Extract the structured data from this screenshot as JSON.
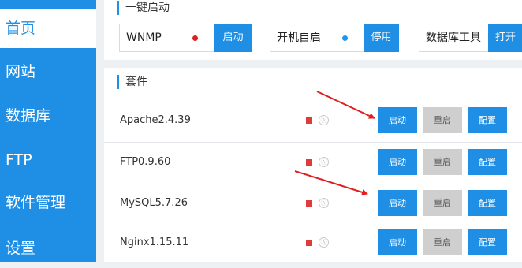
{
  "sidebar": {
    "items": [
      {
        "label": "首页"
      },
      {
        "label": "网站"
      },
      {
        "label": "数据库"
      },
      {
        "label": "FTP"
      },
      {
        "label": "软件管理"
      },
      {
        "label": "设置"
      }
    ]
  },
  "quick_start": {
    "title": "一键启动",
    "items": [
      {
        "label": "WNMP",
        "button": "启动",
        "dot_color": "#e02020"
      },
      {
        "label": "开机自启",
        "button": "停用",
        "dot_color": "#2196e8"
      },
      {
        "label": "数据库工具",
        "button": "打开"
      }
    ]
  },
  "packages": {
    "title": "套件",
    "auto_icon": "Ⓐ",
    "rows": [
      {
        "name": "Apache2.4.39",
        "start": "启动",
        "restart": "重启",
        "config": "配置"
      },
      {
        "name": "FTP0.9.60",
        "start": "启动",
        "restart": "重启",
        "config": "配置"
      },
      {
        "name": "MySQL5.7.26",
        "start": "启动",
        "restart": "重启",
        "config": "配置"
      },
      {
        "name": "Nginx1.15.11",
        "start": "启动",
        "restart": "重启",
        "config": "配置"
      }
    ]
  },
  "colors": {
    "accent": "#1e8fe5",
    "stopped": "#e03b3b",
    "annotation_arrow": "#e02020"
  }
}
